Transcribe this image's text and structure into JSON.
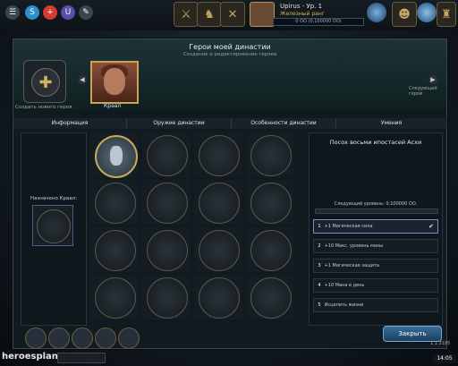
{
  "topbar": {
    "player_name": "Upirus - Ур. 1",
    "player_rank": "Железный ранг",
    "xp_text": "0 ОО (0.100000 ОО)"
  },
  "panel": {
    "title": "Герои моей династии",
    "subtitle": "Создание и редактирование героев",
    "create_hero_label": "Создать нового героя",
    "selected_hero_name": "Краал",
    "next_hero_label": "Следующий герой",
    "prev_arrow": "◀",
    "next_arrow": "▶",
    "create_plus": "✚"
  },
  "tabs": [
    {
      "label": "Информация"
    },
    {
      "label": "Оружие династии"
    },
    {
      "label": "Особенности династии"
    },
    {
      "label": "Умения"
    }
  ],
  "left_column": {
    "assigned_label": "Назначено Краал:"
  },
  "right_column": {
    "set_title": "Посох восьми ипостасей Асхи",
    "next_level_text": "Следующий уровень: 0.100000 ОО.",
    "bonuses": [
      {
        "num": "1",
        "text": "+1 Магическая сила",
        "selected": true
      },
      {
        "num": "2",
        "text": "+10 Макс. уровень маны",
        "selected": false
      },
      {
        "num": "3",
        "text": "+1 Магическая защита",
        "selected": false
      },
      {
        "num": "4",
        "text": "+10 Мана в день",
        "selected": false
      },
      {
        "num": "5",
        "text": "Исцелить жизни",
        "selected": false
      }
    ],
    "check_mark": "✔"
  },
  "buttons": {
    "close_label": "Закрыть"
  },
  "footer": {
    "version": "1.1.3195",
    "watermark": "heroesplanet.ru",
    "clock": "14:05"
  },
  "colors": {
    "gold_accent": "#c7a45a",
    "close_button": "#2b5a85",
    "panel_bg": "#111a20"
  }
}
